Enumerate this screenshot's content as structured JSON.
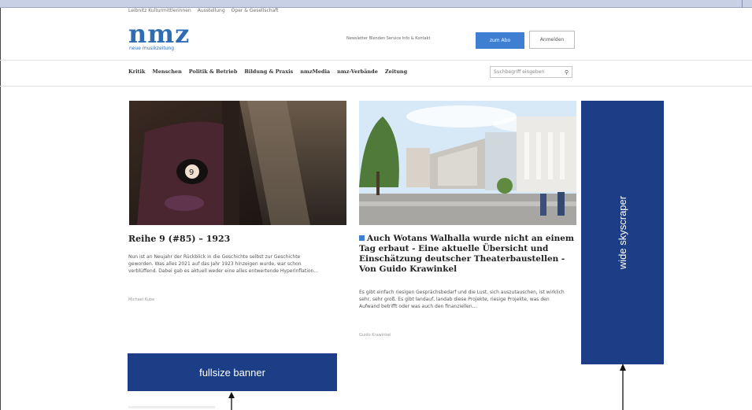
{
  "util_links": [
    "Leibnitz Kulturmittlerinnen",
    "Ausstellung",
    "Oper & Gesellschaft"
  ],
  "logo": {
    "text": "nmz",
    "subtitle": "neue musikzeitung"
  },
  "header": {
    "links_text": "Newsletter Blenden Service Info & Kontakt",
    "abo_button": "zum Abo",
    "login_button": "Anmelden"
  },
  "nav": [
    "Kritik",
    "Menschen",
    "Politik & Betrieb",
    "Bildung & Praxis",
    "nmzMedia",
    "nmz-Verbände",
    "Zeitung"
  ],
  "search": {
    "placeholder": "Suchbegriff eingeben"
  },
  "articles": [
    {
      "title": "Reihe 9 (#85) – 1923",
      "excerpt": "Nun ist an Neujahr der Rückblick in die Geschichte selbst zur Geschichte geworden. Was alles 2021 auf das Jahr 1923 hinzeigen wurde, war schon verblüffend. Dabei gab es aktuell weder eine alles entwertende Hyperinflation...",
      "author": "Michael Kube",
      "image_label": "9"
    },
    {
      "title": "Auch Wotans Walhalla wurde nicht an einem Tag erbaut - Eine aktuelle Übersicht und Einschätzung deutscher Theaterbaustellen - Von Guido Krawinkel",
      "excerpt": "Es gibt einfach riesigen Gesprächsbedarf und die Lust, sich auszutauschen, ist wirklich sehr, sehr groß. Es gibt landauf, landab diese Projekte, riesige Projekte, was den Aufwand betrifft oder was auch den finanziellen...",
      "author": "Guido Krawinkel"
    }
  ],
  "ads": {
    "skyscraper": "wide skyscraper",
    "banner": "fullsize banner"
  },
  "colors": {
    "brand_blue": "#2f6cb3",
    "ad_blue": "#1b3e86",
    "button_blue": "#3f7fd1"
  },
  "icons": {
    "search": "magnifier-icon"
  }
}
